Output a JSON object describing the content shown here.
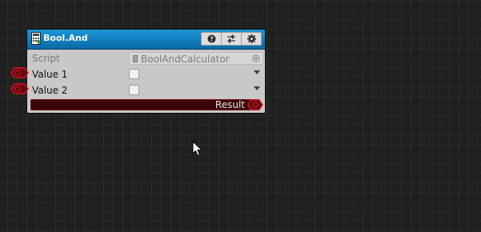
{
  "node": {
    "title": "Bool.And",
    "toolbar": {
      "help_icon": "help-icon",
      "presets_icon": "sliders-icon",
      "settings_icon": "gear-icon"
    },
    "script": {
      "label": "Script",
      "value": "BoolAndCalculator"
    },
    "inputs": [
      {
        "label": "Value 1",
        "checked": false
      },
      {
        "label": "Value 2",
        "checked": false
      }
    ],
    "output": {
      "label": "Result"
    }
  },
  "colors": {
    "header": "#1c96d8",
    "port": "#c8101e",
    "result_bar": "#3a0408",
    "canvas": "#202020"
  }
}
